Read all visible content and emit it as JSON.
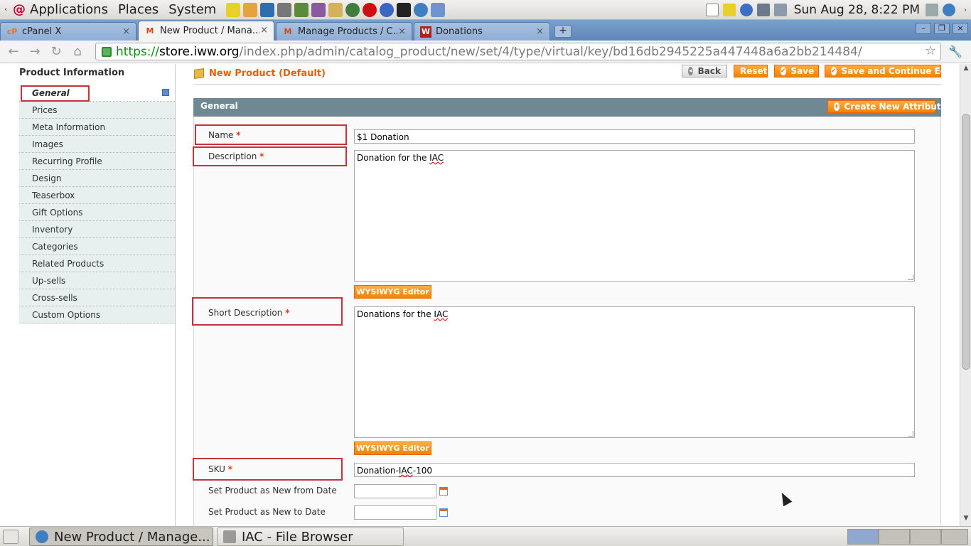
{
  "top_panel": {
    "menus": [
      "Applications",
      "Places",
      "System"
    ],
    "clock": "Sun Aug 28,  8:22 PM"
  },
  "tabs": [
    {
      "title": "cPanel X",
      "favicon": "cP"
    },
    {
      "title": "New Product / Mana...",
      "favicon": "M"
    },
    {
      "title": "Manage Products / C...",
      "favicon": "M"
    },
    {
      "title": "Donations",
      "favicon": "W"
    }
  ],
  "address_bar": {
    "scheme": "https://",
    "host": "store.iww.org",
    "path": "/index.php/admin/catalog_product/new/set/4/type/virtual/key/bd16db2945225a447448a6a2bb214484/"
  },
  "sidebar": {
    "title": "Product Information",
    "items": [
      "General",
      "Prices",
      "Meta Information",
      "Images",
      "Recurring Profile",
      "Design",
      "Teaserbox",
      "Gift Options",
      "Inventory",
      "Categories",
      "Related Products",
      "Up-sells",
      "Cross-sells",
      "Custom Options"
    ]
  },
  "header": {
    "title": "New Product (Default)",
    "back": "Back",
    "reset": "Reset",
    "save": "Save",
    "save_continue": "Save and Continue Edit"
  },
  "section": {
    "title": "General",
    "create_attribute": "Create New Attribute"
  },
  "fields": {
    "name_label": "Name",
    "name_value": "$1 Donation",
    "description_label": "Description",
    "description_value_a": "Donation for the ",
    "description_value_b": "IAC",
    "wysiwyg": "WYSIWYG Editor",
    "short_description_label": "Short Description",
    "short_description_value_a": "Donations for the ",
    "short_description_value_b": "IAC",
    "sku_label": "SKU",
    "sku_value_a": "Donation-",
    "sku_value_b": "IAC",
    "sku_value_c": "-100",
    "new_from_label": "Set Product as New from Date",
    "new_to_label": "Set Product as New to Date",
    "required_mark": "*"
  },
  "taskbar": {
    "tasks": [
      "New Product / Manage...",
      "IAC - File Browser"
    ]
  }
}
